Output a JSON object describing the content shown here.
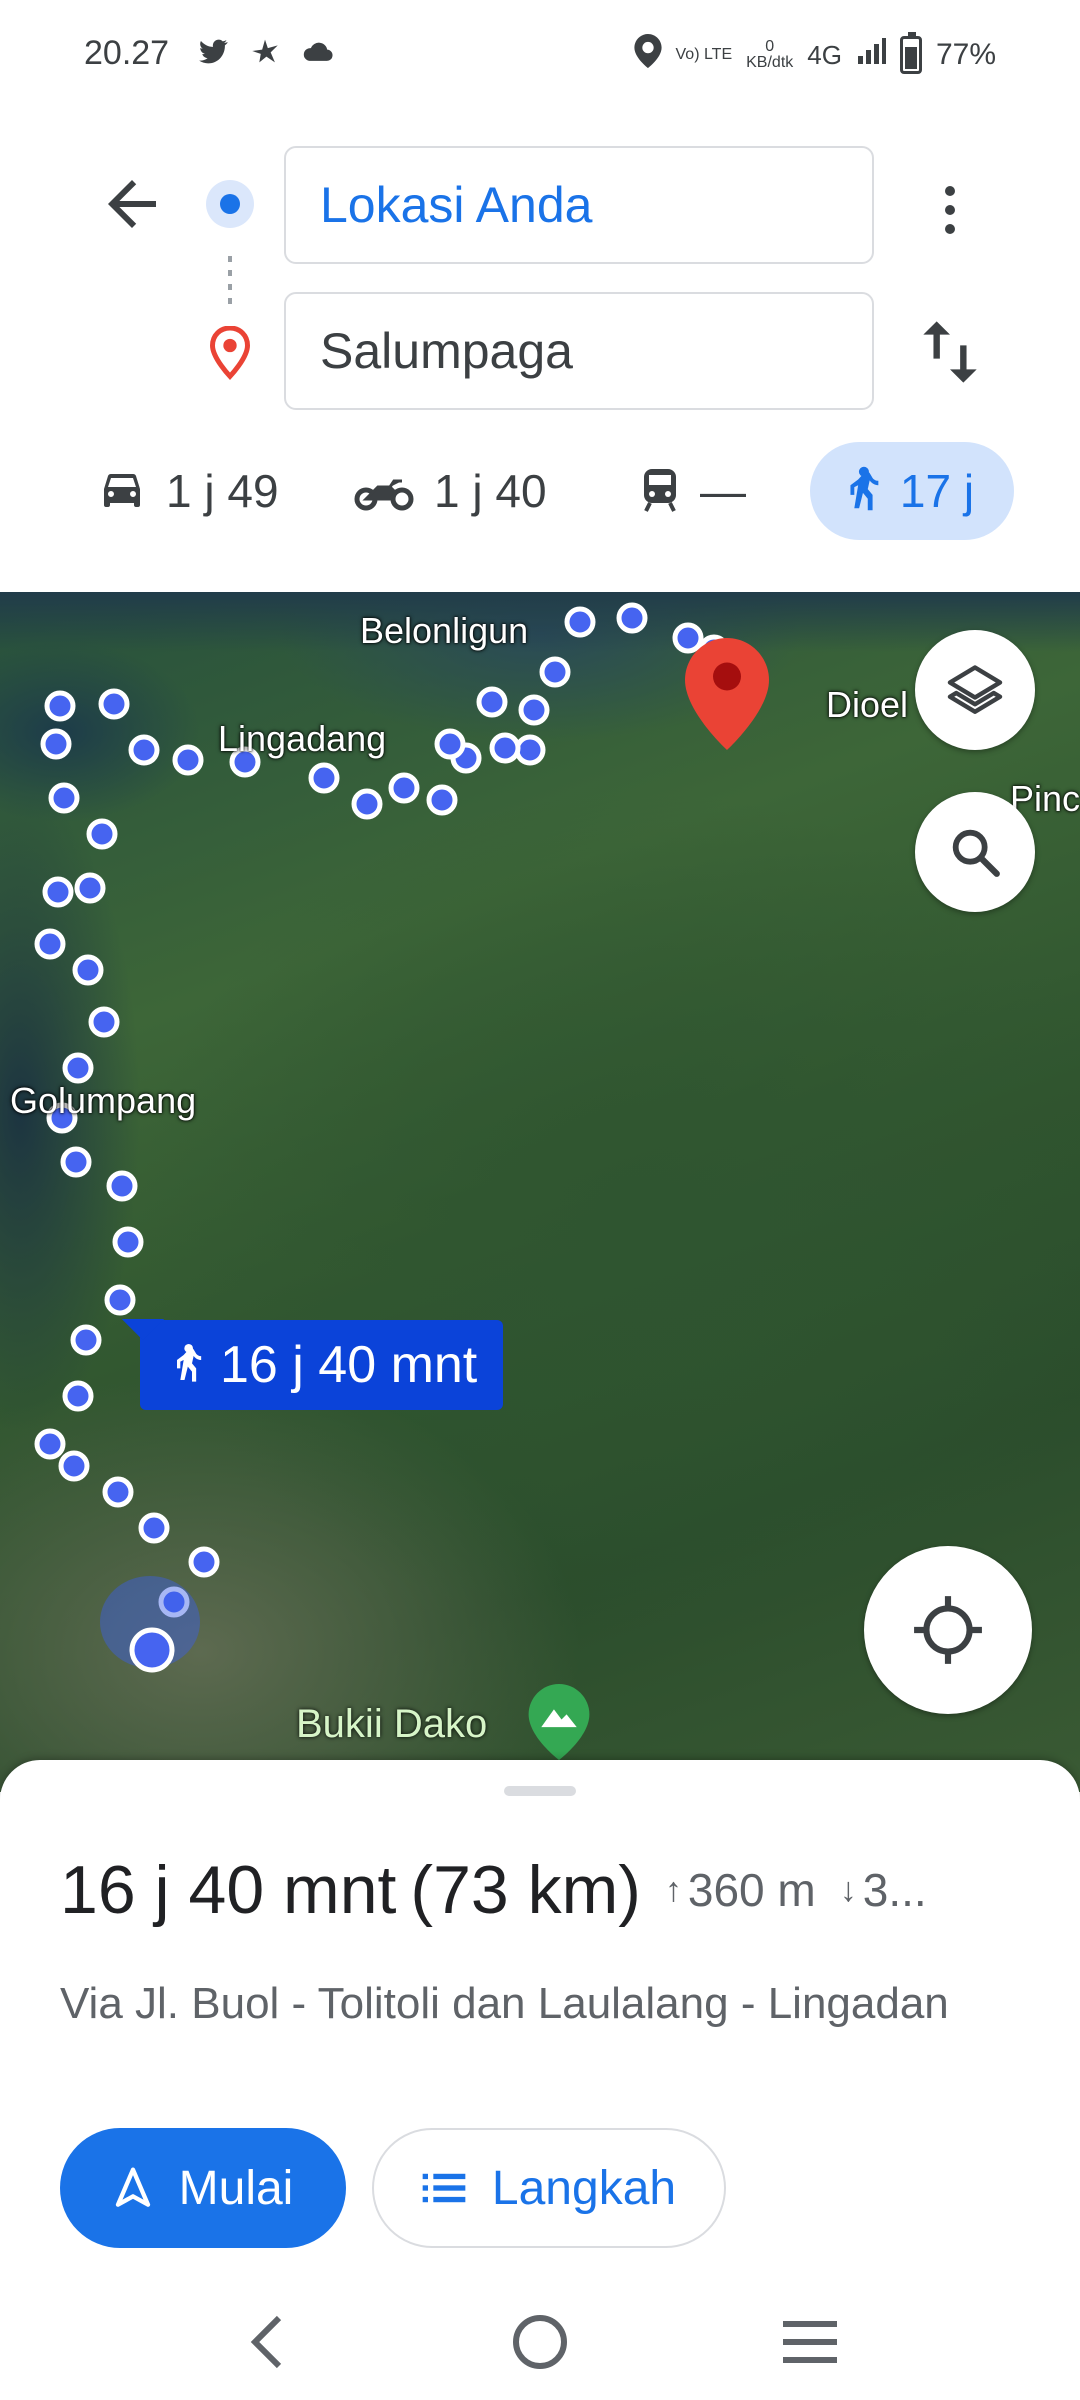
{
  "status_bar": {
    "time": "20.27",
    "left_icons": [
      "twitter-icon",
      "bird-icon",
      "cloud-icon"
    ],
    "volte": "Vo) LTE",
    "speed_value": "0",
    "speed_unit": "KB/dtk",
    "network": "4G",
    "battery": "77%"
  },
  "directions": {
    "origin": "Lokasi Anda",
    "destination": "Salumpaga"
  },
  "travel_modes": [
    {
      "mode": "car",
      "time": "1 j 49"
    },
    {
      "mode": "motorcycle",
      "time": "1 j 40"
    },
    {
      "mode": "transit",
      "time": "—"
    },
    {
      "mode": "walk",
      "time": "17 j",
      "selected": true
    }
  ],
  "map": {
    "labels": {
      "belonligun": "Belonligun",
      "lingadang": "Lingadang",
      "dioel": "Dioel",
      "pinc": "Pinc",
      "golumpang": "Golumpang",
      "bukit_dako": "Bukii Dako"
    },
    "route_badge": "16 j 40 mnt",
    "route_color": "#4664f0",
    "badge_color": "#0b43d9"
  },
  "summary": {
    "duration": "16 j 40 mnt",
    "distance": "(73 km)",
    "ascent": "360 m",
    "descent": "3...",
    "via": "Via Jl. Buol - Tolitoli dan Laulalang - Lingadan",
    "start_label": "Mulai",
    "steps_label": "Langkah"
  },
  "colors": {
    "accent": "#1a73e8",
    "walk_chip": "#d2e3fc",
    "pin_red": "#ea4335"
  }
}
